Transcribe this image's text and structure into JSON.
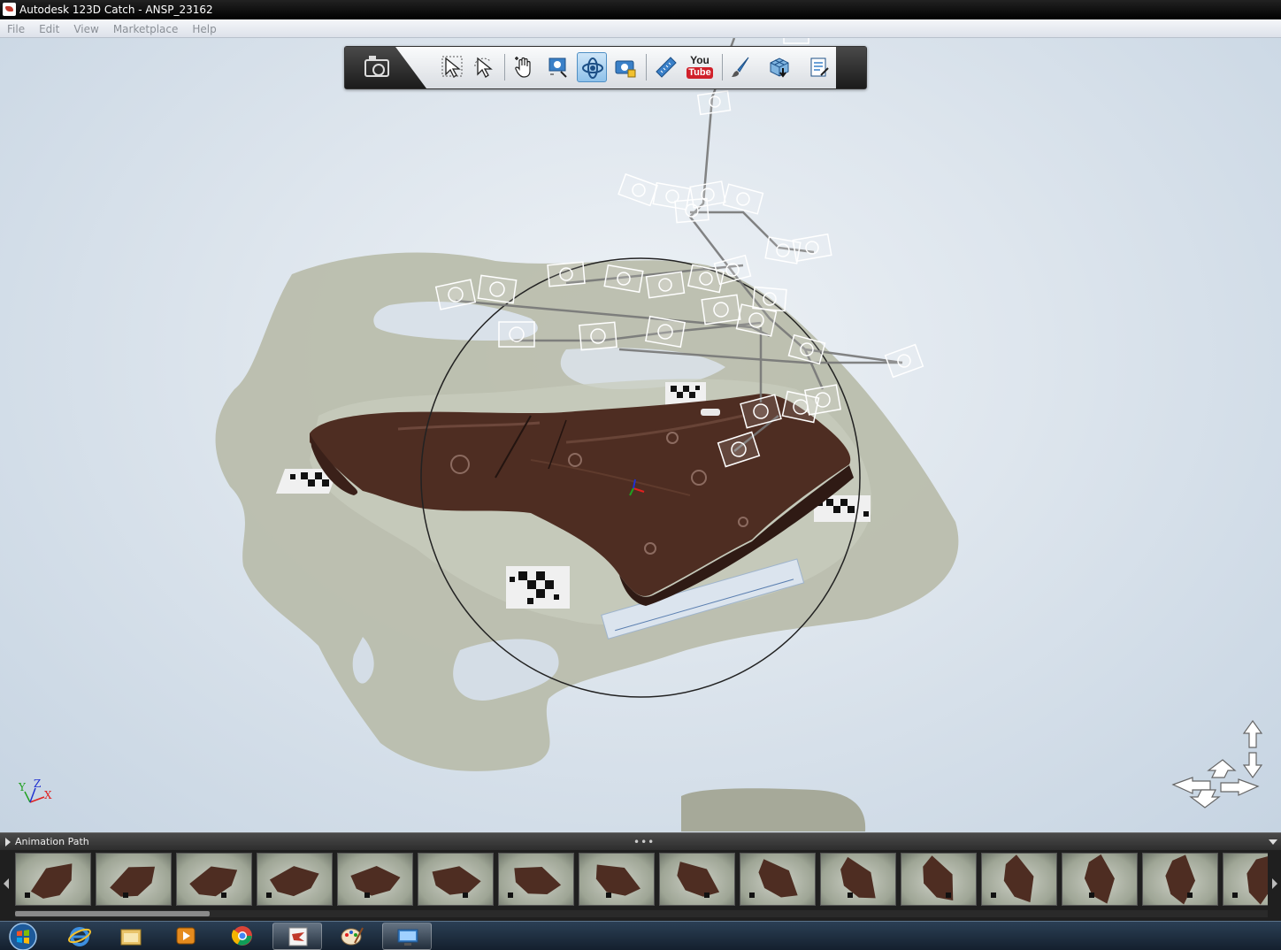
{
  "window": {
    "title": "Autodesk 123D Catch - ANSP_23162"
  },
  "menu": {
    "items": [
      "File",
      "Edit",
      "View",
      "Marketplace",
      "Help"
    ]
  },
  "toolbar": {
    "youtube_you": "You",
    "youtube_tube": "Tube",
    "active_tool": "orbit",
    "tools": [
      "camera-menu",
      "select",
      "lasso-select",
      "pan",
      "zoom",
      "orbit",
      "camera-lock",
      "measure",
      "youtube",
      "paint",
      "export",
      "properties"
    ]
  },
  "axis_triad": {
    "y": "Y",
    "z": "Z",
    "x": "X"
  },
  "bottom_panel": {
    "title": "Animation Path",
    "grip": "•••",
    "thumbnail_count": 16
  },
  "taskbar": {
    "items": [
      "start",
      "internet-explorer",
      "file-explorer",
      "media-player",
      "chrome",
      "123d-catch",
      "paint",
      "remote-desktop"
    ]
  },
  "colors": {
    "background": "#dde5ed",
    "rock": "#4e2d22",
    "mat": "#b8bdae",
    "active_tool": "#8fc2ea",
    "axis_x": "#e02020",
    "axis_y": "#20a020",
    "axis_z": "#2030d0"
  }
}
